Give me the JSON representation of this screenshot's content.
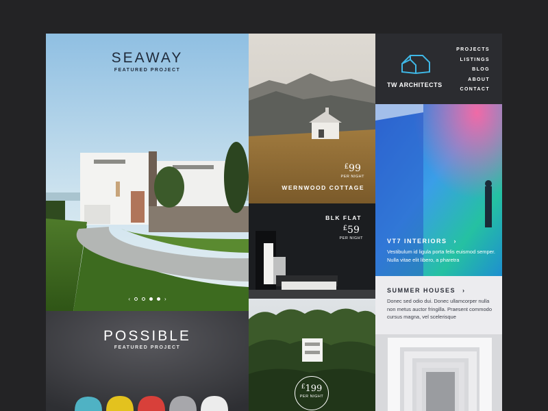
{
  "featured": {
    "seaway_title": "SEAWAY",
    "seaway_sub": "FEATURED PROJECT",
    "possible_title": "POSSIBLE",
    "possible_sub": "FEATURED PROJECT",
    "slider_prev": "‹",
    "slider_next": "›",
    "slider_active_index": 2
  },
  "listings": {
    "wernwood": {
      "currency": "£",
      "price": "99",
      "per": "PER NIGHT",
      "name": "WERNWOOD COTTAGE"
    },
    "blk": {
      "name": "BLK FLAT",
      "currency": "£",
      "price": "59",
      "per": "PER NIGHT"
    },
    "forest": {
      "currency": "£",
      "price": "199",
      "per": "PER NIGHT"
    }
  },
  "brand": {
    "name": "TW ARCHITECTS",
    "logo_icon": "house-outline-icon",
    "accent": "#3fb8e6"
  },
  "nav": [
    "PROJECTS",
    "LISTINGS",
    "BLOG",
    "ABOUT",
    "CONTACT"
  ],
  "vt7": {
    "title": "VT7 INTERIORS",
    "arrow": "›",
    "body": "Vestibulum id ligula porta felis euismod semper. Nulla vitae elit libero, a pharetra"
  },
  "summer": {
    "title": "SUMMER HOUSES",
    "arrow": "›",
    "body": "Donec sed odio dui. Donec ullamcorper nulla non metus auctor fringilla. Praesent commodo cursus magna, vel scelerisque"
  }
}
